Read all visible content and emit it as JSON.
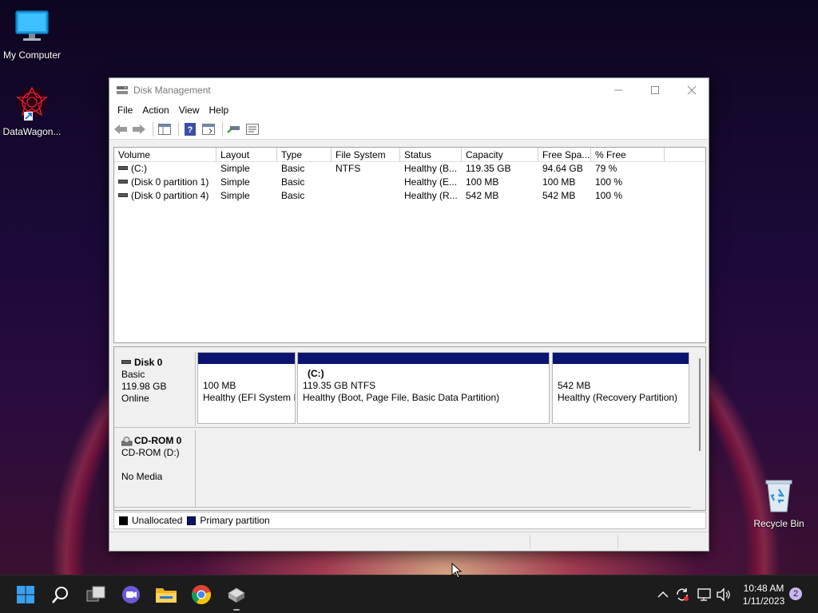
{
  "desktop": {
    "icons": [
      {
        "label": "My Computer"
      },
      {
        "label": "DataWagon..."
      },
      {
        "label": "Recycle Bin"
      }
    ]
  },
  "window": {
    "title": "Disk Management",
    "menu": [
      "File",
      "Action",
      "View",
      "Help"
    ],
    "toolbar_icons": [
      "back-arrow-icon",
      "forward-arrow-icon",
      "console-tree-icon",
      "help-icon",
      "details-icon",
      "connect-icon",
      "properties-icon"
    ]
  },
  "volume_list": {
    "columns": [
      "Volume",
      "Layout",
      "Type",
      "File System",
      "Status",
      "Capacity",
      "Free Spa...",
      "% Free"
    ],
    "rows": [
      [
        "(C:)",
        "Simple",
        "Basic",
        "NTFS",
        "Healthy (B...",
        "119.35 GB",
        "94.64 GB",
        "79 %"
      ],
      [
        "(Disk 0 partition 1)",
        "Simple",
        "Basic",
        "",
        "Healthy (E...",
        "100 MB",
        "100 MB",
        "100 %"
      ],
      [
        "(Disk 0 partition 4)",
        "Simple",
        "Basic",
        "",
        "Healthy (R...",
        "542 MB",
        "542 MB",
        "100 %"
      ]
    ]
  },
  "disks": {
    "disk0": {
      "name": "Disk 0",
      "type": "Basic",
      "size": "119.98 GB",
      "status": "Online",
      "partitions": [
        {
          "title": "",
          "size": "100 MB",
          "status": "Healthy (EFI System I"
        },
        {
          "title": "(C:)",
          "size": "119.35 GB NTFS",
          "status": "Healthy (Boot, Page File, Basic Data Partition)"
        },
        {
          "title": "",
          "size": "542 MB",
          "status": "Healthy (Recovery Partition)"
        }
      ]
    },
    "cdrom0": {
      "name": "CD-ROM 0",
      "drive": "CD-ROM (D:)",
      "media": "No Media"
    }
  },
  "legend": {
    "unallocated": "Unallocated",
    "primary": "Primary partition",
    "unallocated_color": "#000000",
    "primary_color": "#0a1470"
  },
  "taskbar": {
    "icons": [
      "windows-start-icon",
      "search-icon",
      "task-view-icon",
      "chat-icon",
      "file-explorer-icon",
      "chrome-icon",
      "disk-management-icon"
    ],
    "time": "10:48 AM",
    "date": "1/11/2023",
    "notifications": "2"
  }
}
